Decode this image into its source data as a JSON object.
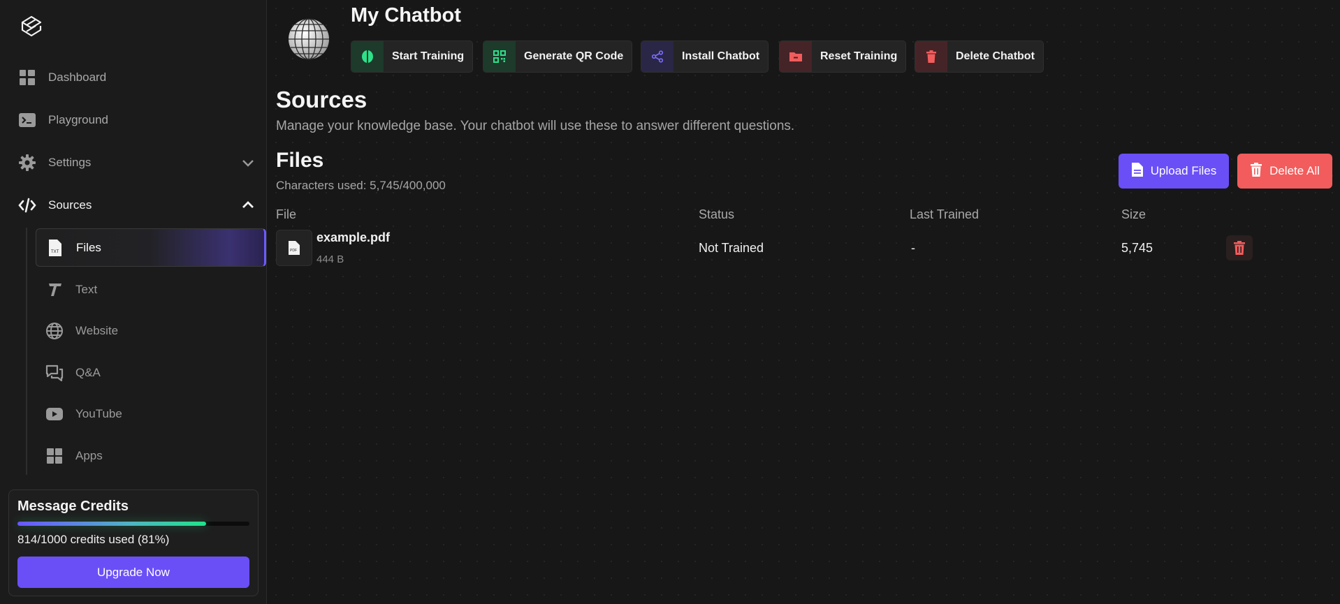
{
  "sidebar": {
    "nav": [
      {
        "label": "Dashboard",
        "icon": "grid-icon"
      },
      {
        "label": "Playground",
        "icon": "terminal-icon"
      },
      {
        "label": "Settings",
        "icon": "gear-icon"
      },
      {
        "label": "Sources",
        "icon": "code-icon"
      }
    ],
    "sources_sub": [
      {
        "label": "Files",
        "icon": "txt-file-icon",
        "active": true
      },
      {
        "label": "Text",
        "icon": "text-t-icon"
      },
      {
        "label": "Website",
        "icon": "globe-icon"
      },
      {
        "label": "Q&A",
        "icon": "chat-bubbles-icon"
      },
      {
        "label": "YouTube",
        "icon": "youtube-icon"
      },
      {
        "label": "Apps",
        "icon": "apps-grid-icon"
      }
    ],
    "credits": {
      "title": "Message Credits",
      "used_text": "814/1000 credits used (81%)",
      "fraction": 0.814,
      "upgrade_label": "Upgrade Now"
    }
  },
  "header": {
    "bot_name": "My Chatbot",
    "actions": [
      {
        "label": "Start Training",
        "icon": "brain-icon",
        "color": "#2ee08a"
      },
      {
        "label": "Generate QR Code",
        "icon": "qr-code-icon",
        "color": "#2ee08a"
      },
      {
        "label": "Install Chatbot",
        "icon": "share-icon",
        "color": "#7b6cff"
      },
      {
        "label": "Reset Training",
        "icon": "folder-minus-icon",
        "color": "#f25c5c"
      },
      {
        "label": "Delete Chatbot",
        "icon": "trash-icon",
        "color": "#f25c5c"
      }
    ]
  },
  "sources": {
    "title": "Sources",
    "description": "Manage your knowledge base. Your chatbot will use these to answer different questions."
  },
  "files": {
    "title": "Files",
    "chars_used": "Characters used: 5,745/400,000",
    "upload_label": "Upload Files",
    "delete_all_label": "Delete All",
    "columns": [
      "File",
      "Status",
      "Last Trained",
      "Size"
    ],
    "rows": [
      {
        "name": "example.pdf",
        "file_size": "444 B",
        "status": "Not Trained",
        "last_trained": "-",
        "size": "5,745"
      }
    ]
  },
  "colors": {
    "accent": "#6a4ff7",
    "danger": "#f25c5c",
    "success": "#2ee08a"
  }
}
